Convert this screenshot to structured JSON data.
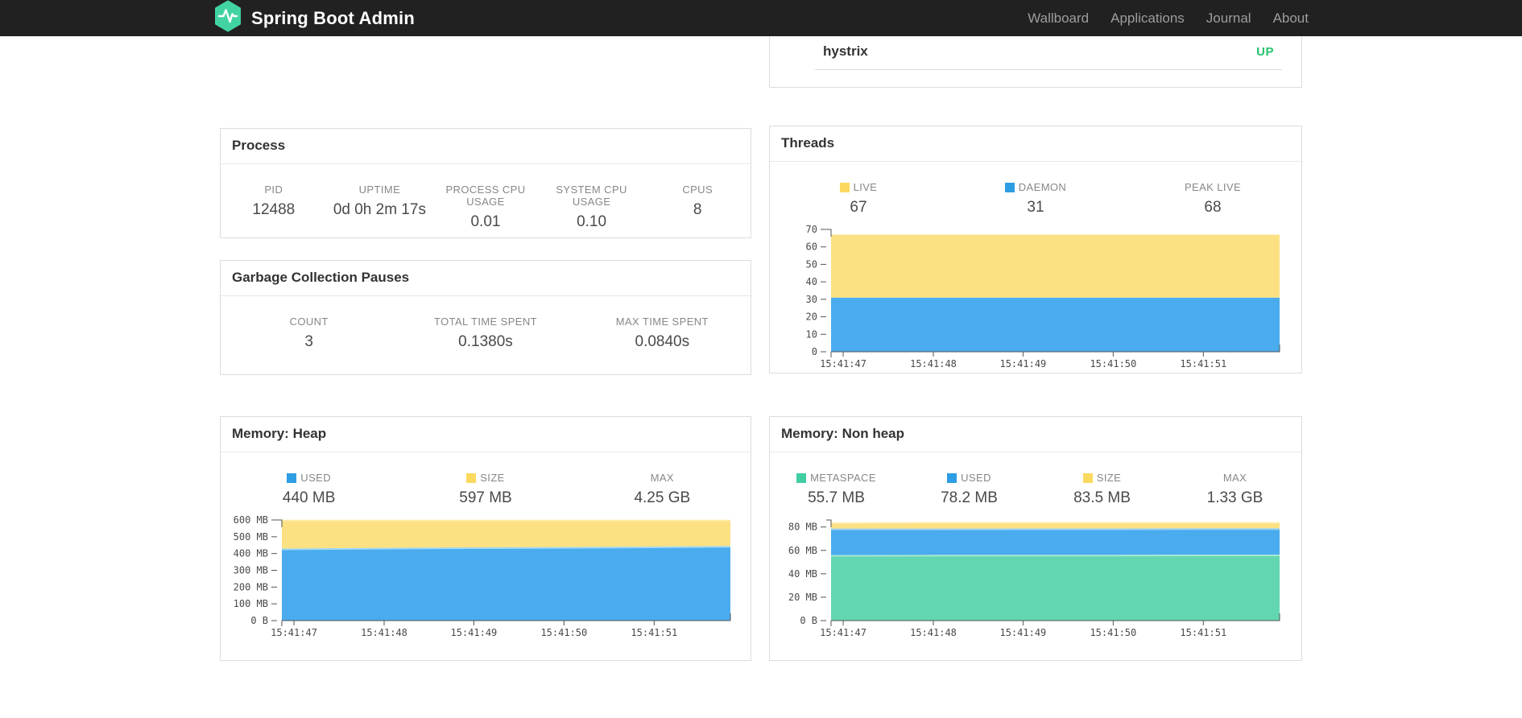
{
  "navbar": {
    "brand": "Spring Boot Admin",
    "links": [
      {
        "label": "Wallboard"
      },
      {
        "label": "Applications"
      },
      {
        "label": "Journal"
      },
      {
        "label": "About"
      }
    ]
  },
  "colors": {
    "navbar_bg": "#212121",
    "logo_green": "#42d3a2",
    "status_up": "#25c26d",
    "chart_blue": "#4aacee",
    "chart_yellow": "#fce183",
    "chart_green": "#62d6b0",
    "legend_blue": "#2d9ee3",
    "legend_yellow": "#fbd95e",
    "legend_green": "#41cda4"
  },
  "hystrix": {
    "name": "hystrix",
    "status": "UP"
  },
  "panels": {
    "process": {
      "title": "Process",
      "stats": [
        {
          "label": "PID",
          "value": "12488"
        },
        {
          "label": "UPTIME",
          "value": "0d 0h 2m 17s"
        },
        {
          "label": "PROCESS CPU USAGE",
          "value": "0.01"
        },
        {
          "label": "SYSTEM CPU USAGE",
          "value": "0.10"
        },
        {
          "label": "CPUS",
          "value": "8"
        }
      ]
    },
    "gc": {
      "title": "Garbage Collection Pauses",
      "stats": [
        {
          "label": "COUNT",
          "value": "3"
        },
        {
          "label": "TOTAL TIME SPENT",
          "value": "0.1380s"
        },
        {
          "label": "MAX TIME SPENT",
          "value": "0.0840s"
        }
      ]
    },
    "threads": {
      "title": "Threads",
      "stats": [
        {
          "label": "LIVE",
          "value": "67",
          "swatch": "#fbd95e"
        },
        {
          "label": "DAEMON",
          "value": "31",
          "swatch": "#2d9ee3"
        },
        {
          "label": "PEAK LIVE",
          "value": "68"
        }
      ]
    },
    "heap": {
      "title": "Memory: Heap",
      "stats": [
        {
          "label": "USED",
          "value": "440 MB",
          "swatch": "#2d9ee3"
        },
        {
          "label": "SIZE",
          "value": "597 MB",
          "swatch": "#fbd95e"
        },
        {
          "label": "MAX",
          "value": "4.25 GB"
        }
      ]
    },
    "nonheap": {
      "title": "Memory: Non heap",
      "stats": [
        {
          "label": "METASPACE",
          "value": "55.7 MB",
          "swatch": "#41cda4"
        },
        {
          "label": "USED",
          "value": "78.2 MB",
          "swatch": "#2d9ee3"
        },
        {
          "label": "SIZE",
          "value": "83.5 MB",
          "swatch": "#fbd95e"
        },
        {
          "label": "MAX",
          "value": "1.33 GB"
        }
      ]
    }
  },
  "chart_data": [
    {
      "type": "area",
      "title": "Threads",
      "stacked": true,
      "grid": false,
      "legend_position": "top",
      "x_ticks": [
        "15:41:47",
        "15:41:48",
        "15:41:49",
        "15:41:50",
        "15:41:51"
      ],
      "ylim": [
        0,
        70
      ],
      "y_ticks": [
        {
          "v": 0,
          "label": "0"
        },
        {
          "v": 10,
          "label": "10"
        },
        {
          "v": 20,
          "label": "20"
        },
        {
          "v": 30,
          "label": "30"
        },
        {
          "v": 40,
          "label": "40"
        },
        {
          "v": 50,
          "label": "50"
        },
        {
          "v": 60,
          "label": "60"
        },
        {
          "v": 70,
          "label": "70"
        }
      ],
      "series": [
        {
          "name": "DAEMON",
          "color": "#4aacee",
          "top": [
            31,
            31,
            31,
            31,
            31,
            31
          ]
        },
        {
          "name": "LIVE",
          "color": "#fce183",
          "top": [
            67,
            67,
            67,
            67,
            67,
            67
          ]
        }
      ]
    },
    {
      "type": "area",
      "title": "Memory: Heap",
      "stacked": true,
      "grid": false,
      "legend_position": "top",
      "x_ticks": [
        "15:41:47",
        "15:41:48",
        "15:41:49",
        "15:41:50",
        "15:41:51"
      ],
      "ylim": [
        0,
        600
      ],
      "y_ticks": [
        {
          "v": 0,
          "label": "0 B"
        },
        {
          "v": 100,
          "label": "100 MB"
        },
        {
          "v": 200,
          "label": "200 MB"
        },
        {
          "v": 300,
          "label": "300 MB"
        },
        {
          "v": 400,
          "label": "400 MB"
        },
        {
          "v": 500,
          "label": "500 MB"
        },
        {
          "v": 600,
          "label": "600 MB"
        }
      ],
      "series": [
        {
          "name": "USED",
          "color": "#4aacee",
          "edge": "#9ed8f7",
          "top": [
            425,
            429,
            432,
            434,
            437,
            440
          ]
        },
        {
          "name": "SIZE",
          "color": "#fce183",
          "edge": "#ffeaa7",
          "top": [
            597,
            597,
            597,
            597,
            597,
            597
          ]
        }
      ]
    },
    {
      "type": "area",
      "title": "Memory: Non heap",
      "stacked": true,
      "grid": false,
      "legend_position": "top",
      "x_ticks": [
        "15:41:47",
        "15:41:48",
        "15:41:49",
        "15:41:50",
        "15:41:51"
      ],
      "ylim": [
        0,
        86
      ],
      "y_ticks": [
        {
          "v": 0,
          "label": "0 B"
        },
        {
          "v": 20,
          "label": "20 MB"
        },
        {
          "v": 40,
          "label": "40 MB"
        },
        {
          "v": 60,
          "label": "60 MB"
        },
        {
          "v": 80,
          "label": "80 MB"
        }
      ],
      "series": [
        {
          "name": "METASPACE",
          "color": "#62d6b0",
          "edge": "#a9e7d2",
          "top": [
            55.4,
            55.5,
            55.5,
            55.6,
            55.7,
            55.7
          ]
        },
        {
          "name": "USED",
          "color": "#4aacee",
          "edge": "#9ed2f3",
          "top": [
            78.0,
            78.0,
            78.1,
            78.1,
            78.2,
            78.2
          ]
        },
        {
          "name": "SIZE",
          "color": "#fce183",
          "edge": "#ffeaa7",
          "top": [
            83.2,
            83.5,
            83.5,
            83.5,
            83.5,
            83.5
          ]
        }
      ]
    }
  ]
}
